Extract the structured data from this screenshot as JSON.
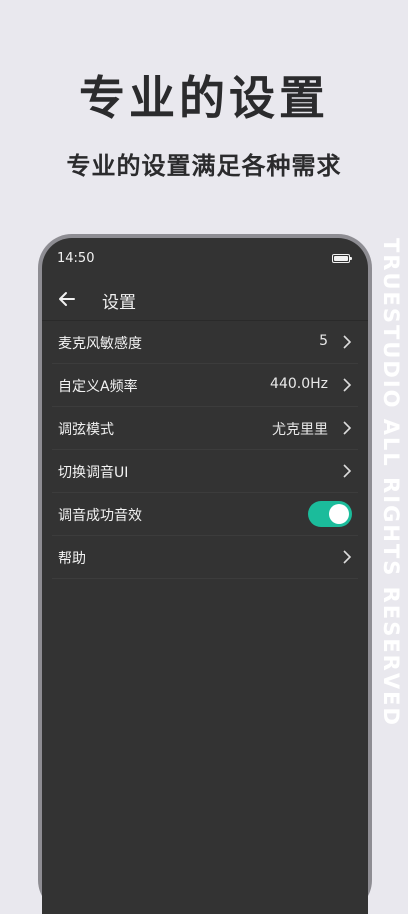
{
  "promo": {
    "headline": "专业的设置",
    "subline": "专业的设置满足各种需求",
    "watermark": "TRUESTUDIO ALL RIGHTS RESERVED"
  },
  "statusbar": {
    "time": "14:50"
  },
  "appbar": {
    "title": "设置",
    "back_icon": "arrow-left-icon"
  },
  "settings": {
    "items": [
      {
        "label": "麦克风敏感度",
        "value": "5"
      },
      {
        "label": "自定义A频率",
        "value": "440.0Hz"
      },
      {
        "label": "调弦模式",
        "value": "尤克里里"
      },
      {
        "label": "切换调音UI",
        "value": ""
      },
      {
        "label": "调音成功音效",
        "toggle_on": true
      },
      {
        "label": "帮助",
        "value": ""
      }
    ]
  },
  "colors": {
    "background": "#e9e8ee",
    "screen": "#333333",
    "accent_toggle": "#1bbc9b",
    "text_dark": "#2b2b2d"
  }
}
